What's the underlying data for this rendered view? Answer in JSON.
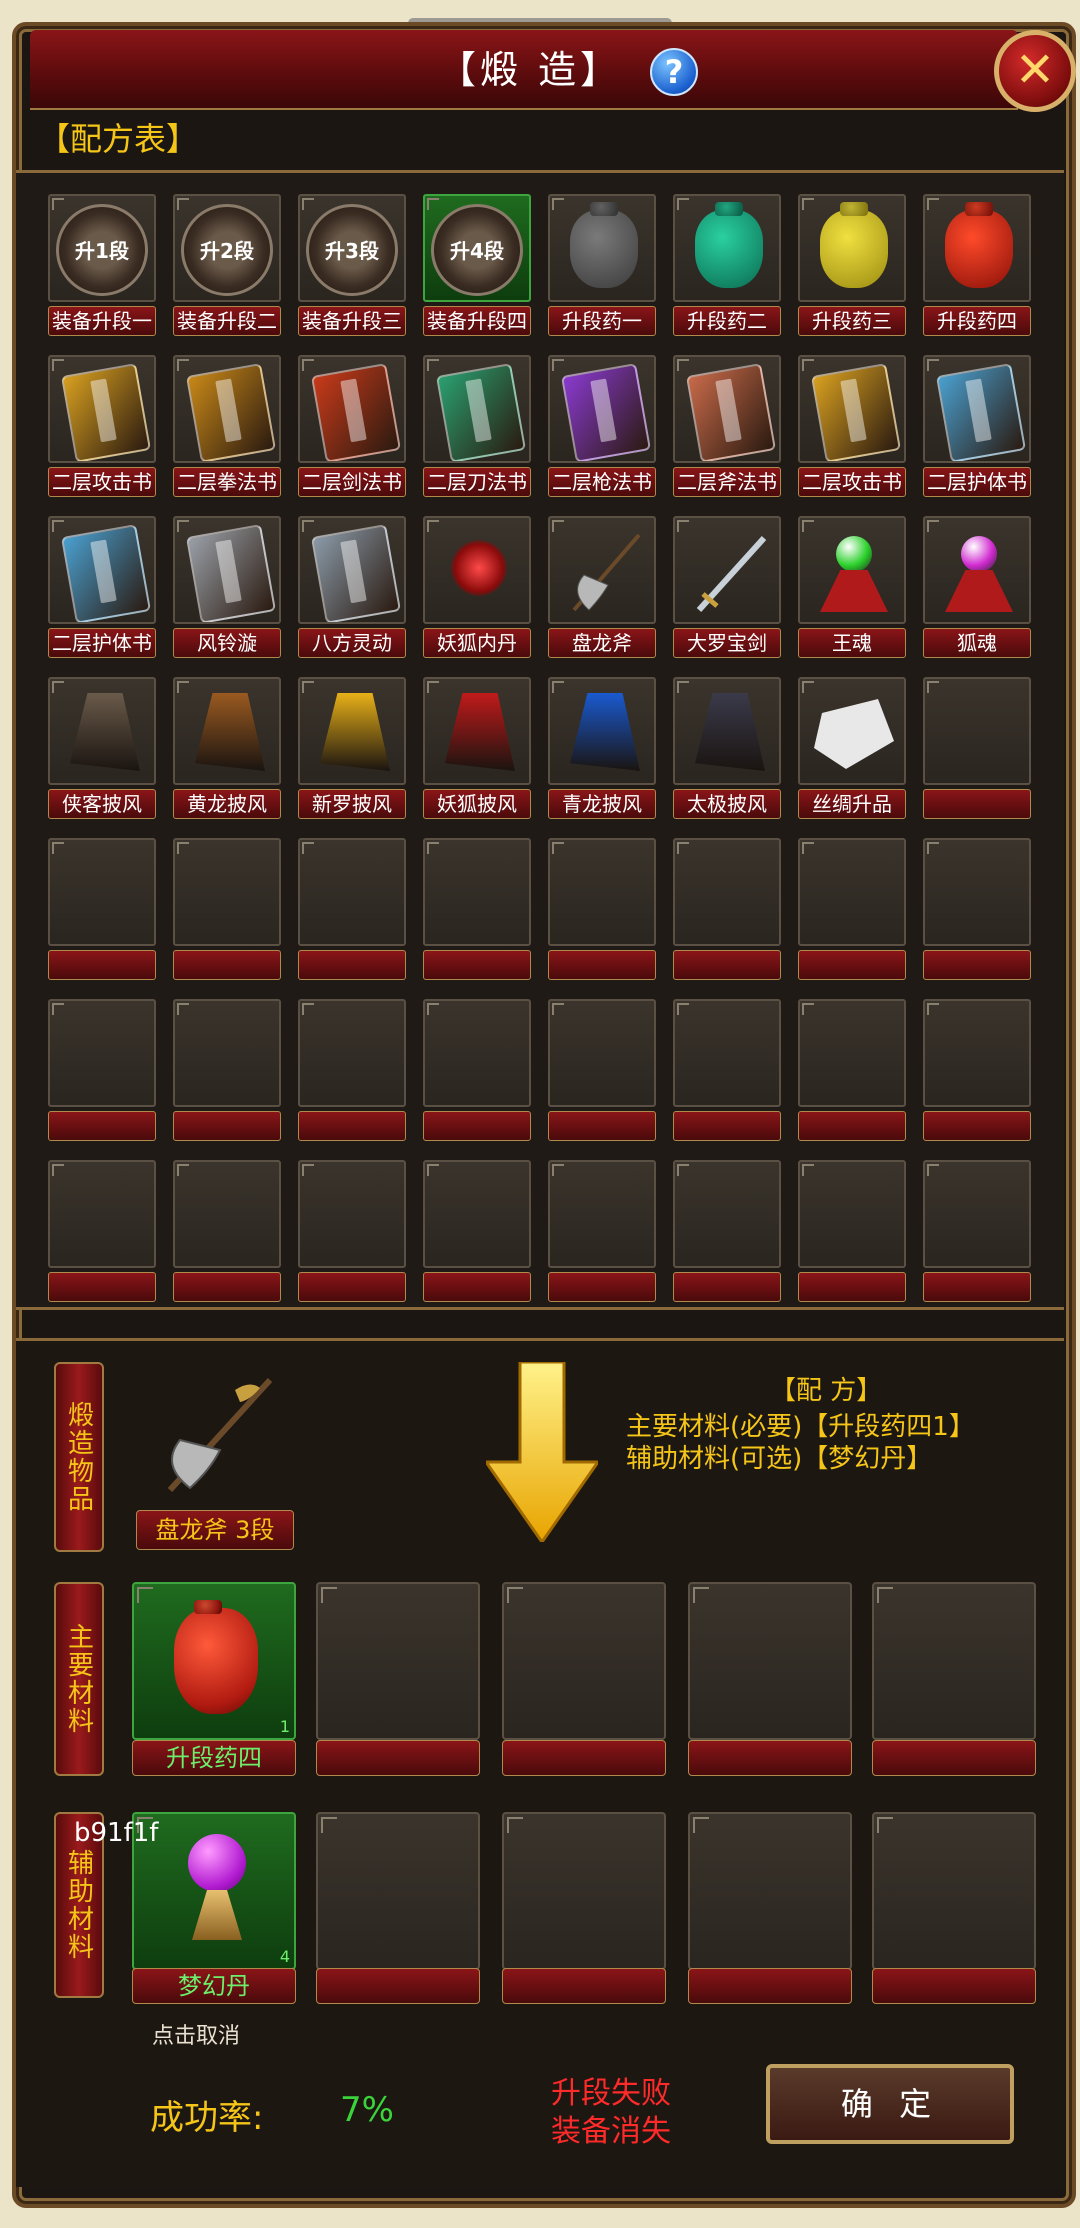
{
  "window": {
    "title": "【煅 造】",
    "help_icon": "?",
    "close_icon": "✕"
  },
  "recipe_table": {
    "label": "【配方表】",
    "rows": [
      [
        "装备升段一",
        "装备升段二",
        "装备升段三",
        "装备升段四",
        "升段药一",
        "升段药二",
        "升段药三",
        "升段药四"
      ],
      [
        "二层攻击书",
        "二层拳法书",
        "二层剑法书",
        "二层刀法书",
        "二层枪法书",
        "二层斧法书",
        "二层攻击书",
        "二层护体书"
      ],
      [
        "二层护体书",
        "风铃漩",
        "八方灵动",
        "妖狐内丹",
        "盘龙斧",
        "大罗宝剑",
        "王魂",
        "狐魂"
      ],
      [
        "侠客披风",
        "黄龙披风",
        "新罗披风",
        "妖狐披风",
        "青龙披风",
        "太极披风",
        "丝绸升品",
        ""
      ],
      [
        "",
        "",
        "",
        "",
        "",
        "",
        "",
        ""
      ],
      [
        "",
        "",
        "",
        "",
        "",
        "",
        "",
        ""
      ],
      [
        "",
        "",
        "",
        "",
        "",
        "",
        "",
        ""
      ]
    ],
    "medal_texts": [
      "升1段",
      "升2段",
      "升3段",
      "升4段"
    ]
  },
  "forge": {
    "item_tab": "煅造物品",
    "item_name": "盘龙斧 3段",
    "recipe_title": "【配 方】",
    "main_material_line": "主要材料(必要)【升段药四1】",
    "aux_material_line": "辅助材料(可选)【梦幻丹】",
    "main_tab": "主要材料",
    "aux_tab": "辅助材料",
    "main_slot": {
      "name": "升段药四",
      "count": "1"
    },
    "aux_slot": {
      "name": "梦幻丹",
      "count": "4"
    },
    "overlay_text": "b91f1f",
    "cancel_hint": "点击取消",
    "success_label": "成功率:",
    "success_value": "7%",
    "fail_line1": "升段失败",
    "fail_line2": "装备消失",
    "confirm_label": "确 定"
  },
  "colors": {
    "accent_gold": "#f5c518",
    "frame_red": "#8a1518",
    "success_green": "#3ad43a",
    "warning_red": "#ff2a2a"
  }
}
